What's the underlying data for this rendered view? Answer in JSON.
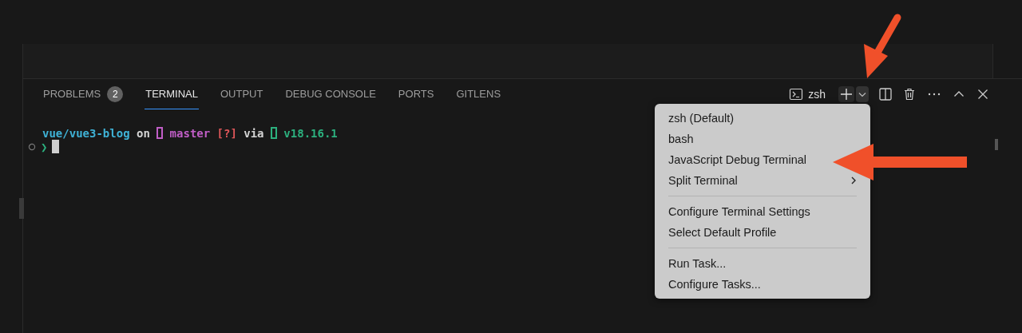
{
  "tabs": [
    {
      "label": "PROBLEMS",
      "badge": "2",
      "selected": false
    },
    {
      "label": "TERMINAL",
      "selected": true
    },
    {
      "label": "OUTPUT",
      "selected": false
    },
    {
      "label": "DEBUG CONSOLE",
      "selected": false
    },
    {
      "label": "PORTS",
      "selected": false
    },
    {
      "label": "GITLENS",
      "selected": false
    }
  ],
  "toolbar": {
    "profile": "zsh"
  },
  "terminal": {
    "prompt": [
      {
        "kind": "text",
        "text": "vue/vue3-blog",
        "color": "#3fb2d6"
      },
      {
        "kind": "text",
        "text": "on",
        "color": "#d4d4d4"
      },
      {
        "kind": "glyph",
        "color": "#c15ec7"
      },
      {
        "kind": "text",
        "text": "master",
        "color": "#c15ec7"
      },
      {
        "kind": "text",
        "text": "[?]",
        "color": "#e0575a"
      },
      {
        "kind": "text",
        "text": "via",
        "color": "#d4d4d4"
      },
      {
        "kind": "glyph",
        "color": "#2cb07e"
      },
      {
        "kind": "text",
        "text": "v18.16.1",
        "color": "#2cb07e"
      }
    ],
    "input_marker": "❯"
  },
  "menu": {
    "groups": [
      [
        {
          "label": "zsh (Default)",
          "submenu": false
        },
        {
          "label": "bash",
          "submenu": false
        },
        {
          "label": "JavaScript Debug Terminal",
          "submenu": false
        },
        {
          "label": "Split Terminal",
          "submenu": true
        }
      ],
      [
        {
          "label": "Configure Terminal Settings",
          "submenu": false
        },
        {
          "label": "Select Default Profile",
          "submenu": false
        }
      ],
      [
        {
          "label": "Run Task...",
          "submenu": false
        },
        {
          "label": "Configure Tasks...",
          "submenu": false
        }
      ]
    ]
  }
}
